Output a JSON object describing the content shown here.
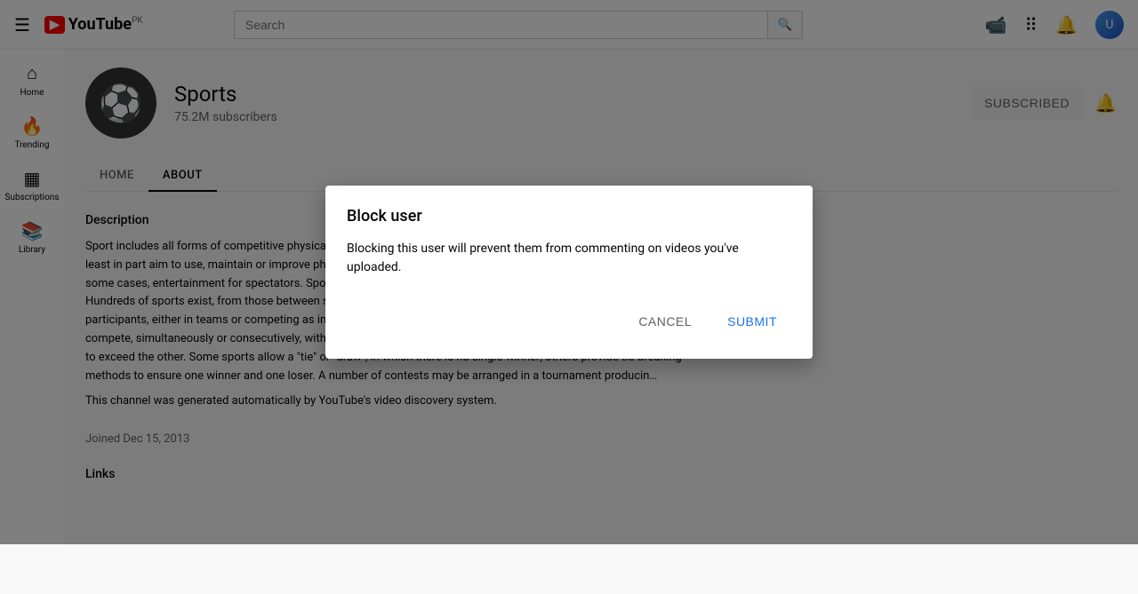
{
  "header": {
    "menu_icon": "☰",
    "logo_yt": "▶",
    "logo_text": "YouTube",
    "logo_country": "PK",
    "search_placeholder": "Search",
    "search_icon": "🔍",
    "upload_icon": "📹",
    "apps_icon": "⠿",
    "bell_icon": "🔔"
  },
  "sidebar": {
    "items": [
      {
        "id": "home",
        "icon": "⌂",
        "label": "Home"
      },
      {
        "id": "trending",
        "icon": "🔥",
        "label": "Trending"
      },
      {
        "id": "subscriptions",
        "icon": "▦",
        "label": "Subscriptions"
      },
      {
        "id": "library",
        "icon": "📚",
        "label": "Library"
      }
    ]
  },
  "channel": {
    "name": "Sports",
    "subscribers": "75.2M subscribers",
    "subscribed_label": "SUBSCRIBED",
    "tabs": [
      {
        "id": "home",
        "label": "HOME",
        "active": false
      },
      {
        "id": "about",
        "label": "ABOUT",
        "active": true
      }
    ],
    "description_title": "Description",
    "description_text": "Sport includes all forms of competitive physical activity or games which, through casual or organised participation, at least in part aim to use, maintain or improve physical ability and skills while providing enjoyment to participants, and in some cases, entertainment for spectators. Sport can, through casual participation, improve one's physical health. Hundreds of sports exist, from those between single individuals, through to those with hundreds of simultaneous participants, either in teams or competing as individuals. In certain sports such as racing, many contestants may compete, simultaneously or consecutively, with one winner; in others, the contest is between two sides, each attempting to exceed the other. Some sports allow a \"tie\" or \"draw\", in which there is no single winner; others provide tie-breaking methods to ensure one winner and one loser. A number of contests may be arranged in a tournament producin…",
    "auto_generated": "This channel was generated automatically by YouTube's video discovery system.",
    "joined_label": "Joined",
    "joined_date": "Dec 15, 2013",
    "links_title": "Links"
  },
  "dialog": {
    "title": "Block user",
    "message": "Blocking this user will prevent them from commenting on videos you've uploaded.",
    "cancel_label": "CANCEL",
    "submit_label": "SUBMIT"
  },
  "colors": {
    "accent": "#ff0000",
    "submit_blue": "#1a73e8",
    "subscribed_bg": "#f2f2f2",
    "tab_active": "#030303"
  }
}
